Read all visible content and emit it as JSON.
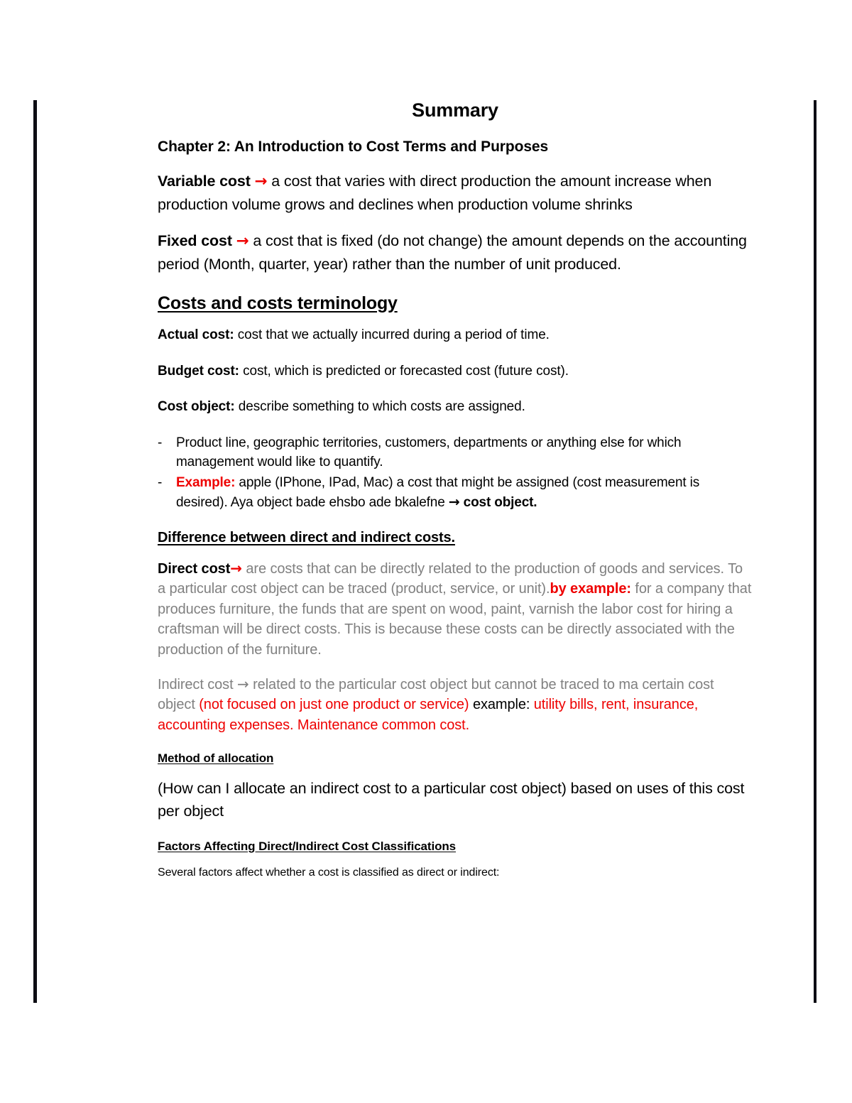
{
  "document": {
    "title": "Summary",
    "chapter_heading": "Chapter 2: An Introduction to Cost Terms and Purposes"
  },
  "colors": {
    "red_accent": "#ee0000",
    "gray_body": "#808080",
    "black_body": "#000000",
    "rule": "#0d0d14"
  },
  "glyphs": {
    "arrow": "→",
    "dash_bullet": "-"
  },
  "variable_cost": {
    "term": "Variable cost",
    "arrow": "→",
    "definition": " a cost that varies with direct production the amount increase when production volume grows and declines when production volume shrinks"
  },
  "fixed_cost": {
    "term": "Fixed cost",
    "arrow": "→",
    "definition": " a cost that is fixed (do not change) the amount depends on the accounting period (Month, quarter, year) rather than the number of unit produced."
  },
  "terminology": {
    "heading": "Costs and costs terminology ",
    "definitions": [
      {
        "term": "Actual cost:",
        "text": "  cost that we actually incurred during a period of time."
      },
      {
        "term": "Budget cost:",
        "text": " cost, which is predicted or forecasted cost (future cost)."
      },
      {
        "term": "Cost object:",
        "text": " describe something to which costs are assigned."
      }
    ],
    "bullets": {
      "first": "Product line, geographic territories, customers, departments or anything else for which management would like to quantify.",
      "second_label": "Example:",
      "second_text": " apple (IPhone, IPad, Mac) a cost that might be assigned (cost measurement is desired). Aya object bade ehsbo ade bkalefne ",
      "second_arrow": "→",
      "second_tail": " cost object."
    }
  },
  "direct_indirect": {
    "heading": "Difference between direct and indirect costs.",
    "direct": {
      "term": "Direct cost",
      "arrow": "→",
      "text_part1": " are costs that can be directly related to the production of goods and services.  To a particular cost object can be traced (product, service, or unit).",
      "by_example_label": "by example:",
      "text_part2": " for a company that produces furniture, the funds that are spent on wood, paint, varnish the labor cost for hiring a craftsman will be direct costs. This is because these costs can be directly associated with the production of the furniture."
    },
    "indirect": {
      "lead": "Indirect cost ",
      "arrow": "→",
      "text_part1": " related to the particular cost object but cannot be traced to ma certain cost object ",
      "red_part1": "(not focused on just one product or service)",
      "text_part2": " example: ",
      "red_part2": "utility bills, rent, insurance, accounting expenses. Maintenance common cost."
    }
  },
  "allocation": {
    "heading": "Method of allocation ",
    "body": "(How can I allocate an indirect cost to a particular cost object) based on uses of this cost per object"
  },
  "factors": {
    "heading": "Factors Affecting Direct/Indirect Cost Classifications",
    "intro": "Several factors affect whether a cost is classified as direct or indirect:"
  }
}
